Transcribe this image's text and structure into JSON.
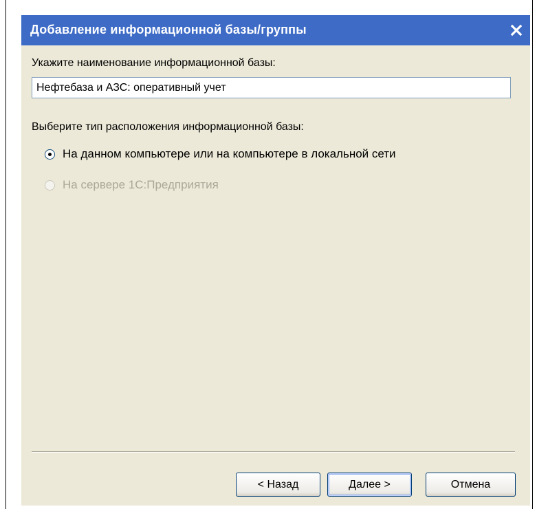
{
  "dialog": {
    "title": "Добавление информационной базы/группы",
    "close_icon": "close-icon"
  },
  "name_section": {
    "label": "Укажите наименование информационной базы:",
    "value": "Нефтебаза и АЗС: оперативный учет"
  },
  "location_section": {
    "label": "Выберите тип расположения информационной базы:",
    "options": [
      {
        "label": "На данном компьютере или на компьютере в локальной сети",
        "selected": true,
        "enabled": true
      },
      {
        "label": "На сервере 1С:Предприятия",
        "selected": false,
        "enabled": false
      }
    ]
  },
  "buttons": {
    "back": "< Назад",
    "next": "Далее >",
    "cancel": "Отмена"
  },
  "colors": {
    "titlebar": "#3d6bc6",
    "dialog_bg": "#ece9d8",
    "disabled_text": "#aca899"
  }
}
